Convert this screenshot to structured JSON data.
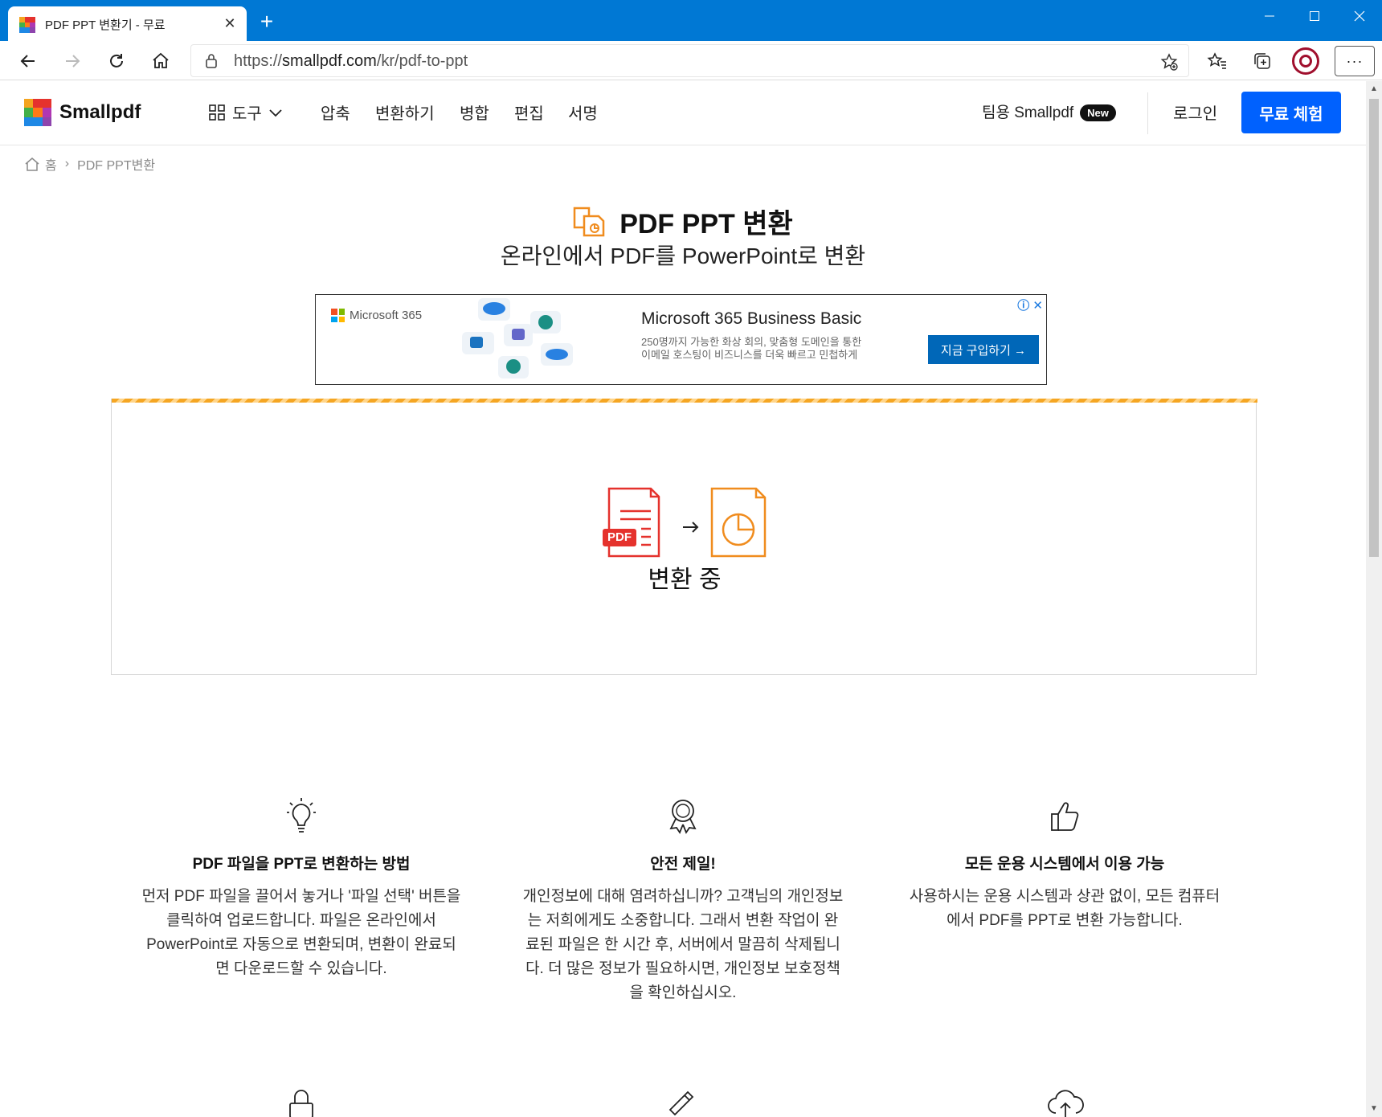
{
  "browser": {
    "tab_title": "PDF PPT 변환기 - 무료",
    "url_scheme": "https://",
    "url_host": "smallpdf.com",
    "url_path": "/kr/pdf-to-ppt"
  },
  "nav": {
    "logo": "Smallpdf",
    "tools_label": "도구",
    "items": [
      "압축",
      "변환하기",
      "병합",
      "편집",
      "서명"
    ],
    "team_label": "팀용 Smallpdf",
    "new_badge": "New",
    "login": "로그인",
    "cta": "무료 체험"
  },
  "breadcrumb": {
    "home": "홈",
    "separator": "›",
    "current": "PDF PPT변환"
  },
  "hero": {
    "title": "PDF PPT 변환",
    "subtitle": "온라인에서 PDF를 PowerPoint로 변환"
  },
  "ad": {
    "brand": "Microsoft 365",
    "title": "Microsoft 365 Business Basic",
    "desc_line1": "250명까지 가능한 화상 회의, 맞춤형 도메인을 통한",
    "desc_line2": "이메일 호스팅이 비즈니스를 더욱 빠르고 민첩하게",
    "button": "지금 구입하기 →",
    "info": "ⓘ",
    "close": "✕"
  },
  "converter": {
    "pdf_label": "PDF",
    "arrow": "→",
    "status": "변환 중",
    "progress": 1.0
  },
  "features": [
    {
      "icon": "lightbulb-icon",
      "title": "PDF 파일을 PPT로 변환하는 방법",
      "text": "먼저 PDF 파일을 끌어서 놓거나 '파일 선택' 버튼을 클릭하여 업로드합니다. 파일은 온라인에서 PowerPoint로 자동으로 변환되며, 변환이 완료되면 다운로드할 수 있습니다."
    },
    {
      "icon": "award-icon",
      "title": "안전 제일!",
      "text": "개인정보에 대해 염려하십니까? 고객님의 개인정보는 저희에게도 소중합니다. 그래서 변환 작업이 완료된 파일은 한 시간 후, 서버에서 말끔히 삭제됩니다. 더 많은 정보가 필요하시면, 개인정보 보호정책을 확인하십시오."
    },
    {
      "icon": "thumbs-up-icon",
      "title": "모든 운용 시스템에서 이용 가능",
      "text": "사용하시는 운용 시스템과 상관 없이, 모든 컴퓨터에서 PDF를 PPT로 변환 가능합니다."
    }
  ],
  "colors": {
    "titlebar": "#0078d4",
    "cta": "#0061fe",
    "accent_orange": "#f08c1e",
    "pdf_red": "#e5322d"
  }
}
